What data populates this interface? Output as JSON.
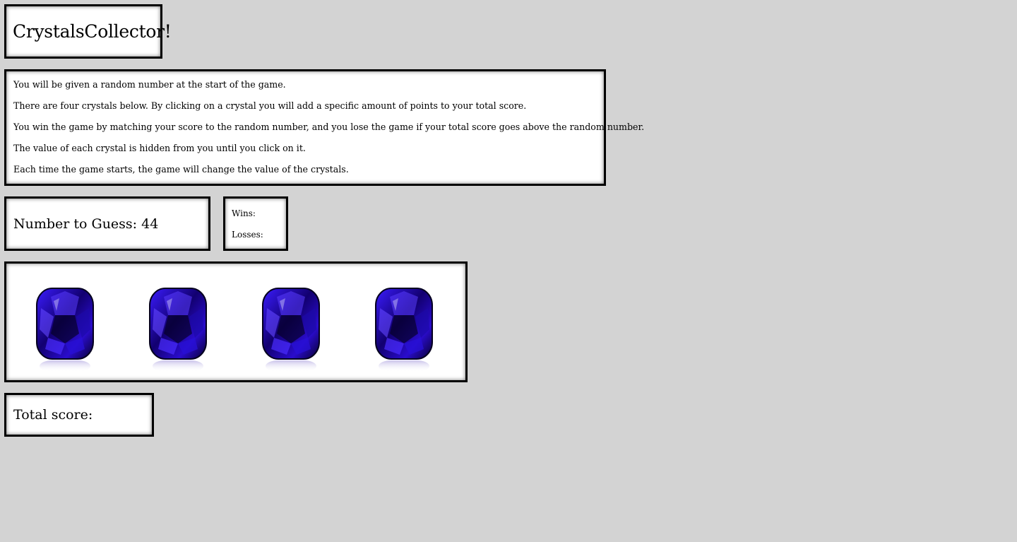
{
  "title": "CrystalsCollector!",
  "instructions": [
    "You will be given a random number at the start of the game.",
    "There are four crystals below. By clicking on a crystal you will add a specific amount of points to your total score.",
    "You win the game by matching your score to the random number, and you lose the game if your total score goes above the random number.",
    "The value of each crystal is hidden from you until you click on it.",
    "Each time the game starts, the game will change the value of the crystals."
  ],
  "guess": {
    "label": "Number to Guess: 44"
  },
  "stats": {
    "wins_label": "Wins:",
    "losses_label": "Losses:"
  },
  "crystals": [
    {
      "icon": "crystal-icon",
      "color": "#2a0ccc"
    },
    {
      "icon": "crystal-icon",
      "color": "#2a0ccc"
    },
    {
      "icon": "crystal-icon",
      "color": "#2a0ccc"
    },
    {
      "icon": "crystal-icon",
      "color": "#2a0ccc"
    }
  ],
  "score": {
    "label": "Total score:"
  },
  "colors": {
    "background": "#d3d3d3",
    "panel": "#ffffff",
    "border": "#000000",
    "gem_dark": "#0a0040",
    "gem_bright": "#3b1cff"
  }
}
